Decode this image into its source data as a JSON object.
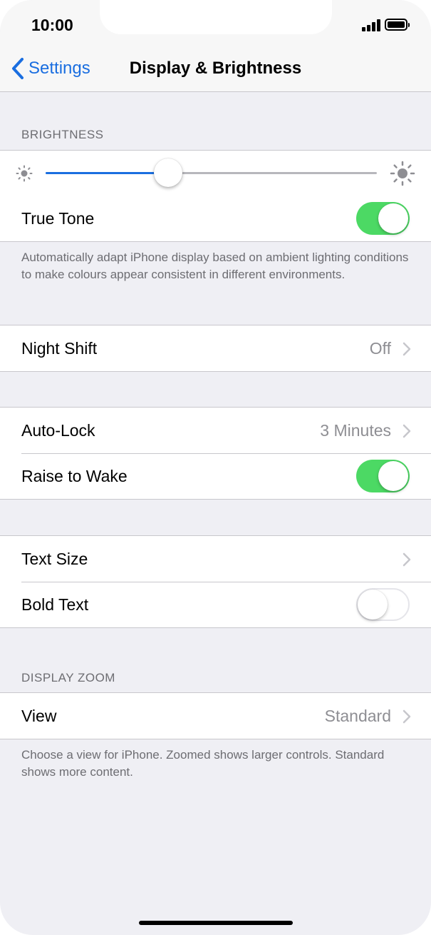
{
  "status_bar": {
    "time": "10:00"
  },
  "nav": {
    "back_label": "Settings",
    "title": "Display & Brightness"
  },
  "brightness": {
    "header": "BRIGHTNESS",
    "level": 0.37,
    "true_tone": {
      "label": "True Tone",
      "on": true
    },
    "footer": "Automatically adapt iPhone display based on ambient lighting conditions to make colours appear consistent in different environments."
  },
  "night_shift": {
    "label": "Night Shift",
    "value": "Off"
  },
  "lock": {
    "auto_lock": {
      "label": "Auto-Lock",
      "value": "3 Minutes"
    },
    "raise_to_wake": {
      "label": "Raise to Wake",
      "on": true
    }
  },
  "text": {
    "text_size": {
      "label": "Text Size"
    },
    "bold_text": {
      "label": "Bold Text",
      "on": false
    }
  },
  "display_zoom": {
    "header": "DISPLAY ZOOM",
    "view": {
      "label": "View",
      "value": "Standard"
    },
    "footer": "Choose a view for iPhone. Zoomed shows larger controls. Standard shows more content."
  },
  "colors": {
    "accent": "#1a6ee0",
    "toggle_on": "#4cd964",
    "background": "#efeff4",
    "secondary_text": "#8e8e93"
  },
  "icons": [
    "back-chevron-icon",
    "signal-icon",
    "battery-icon",
    "brightness-low-icon",
    "brightness-high-icon",
    "chevron-right-icon"
  ]
}
